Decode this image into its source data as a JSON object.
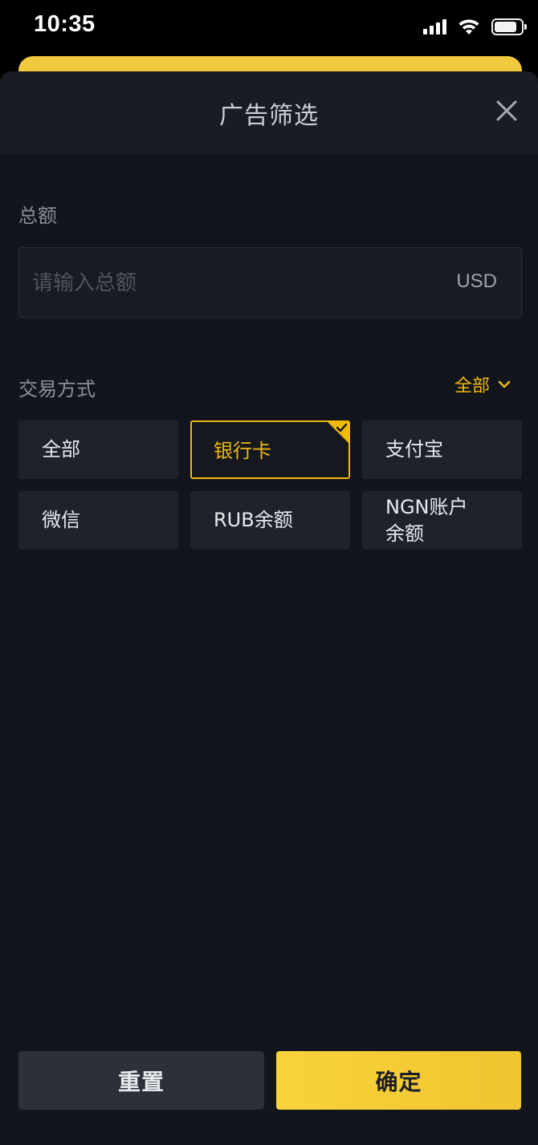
{
  "status_bar": {
    "time": "10:35",
    "signal_bars": 4,
    "battery_level": 0.85,
    "icons": [
      "cellular-signal-icon",
      "wifi-icon",
      "battery-icon"
    ]
  },
  "sheet": {
    "title": "广告筛选",
    "close_icon": "close-icon"
  },
  "amount": {
    "label": "总额",
    "placeholder": "请输入总额",
    "value": "",
    "unit": "USD"
  },
  "payment": {
    "label": "交易方式",
    "filter_label": "全部",
    "filter_icon": "chevron-down-icon",
    "methods": [
      {
        "label": "全部",
        "selected": false
      },
      {
        "label": "银行卡",
        "selected": true
      },
      {
        "label": "支付宝",
        "selected": false
      },
      {
        "label": "微信",
        "selected": false
      },
      {
        "label": "RUB余额",
        "selected": false
      },
      {
        "label": "NGN账户\n余额",
        "selected": false
      }
    ]
  },
  "actions": {
    "reset_label": "重置",
    "confirm_label": "确定"
  },
  "colors": {
    "accent": "#F0B90B",
    "confirm_bg": "#F5CB35",
    "sheet_bg": "#12151C",
    "header_bg": "#191C24",
    "chip_bg": "#1E222B",
    "reset_bg": "#2B3039"
  }
}
